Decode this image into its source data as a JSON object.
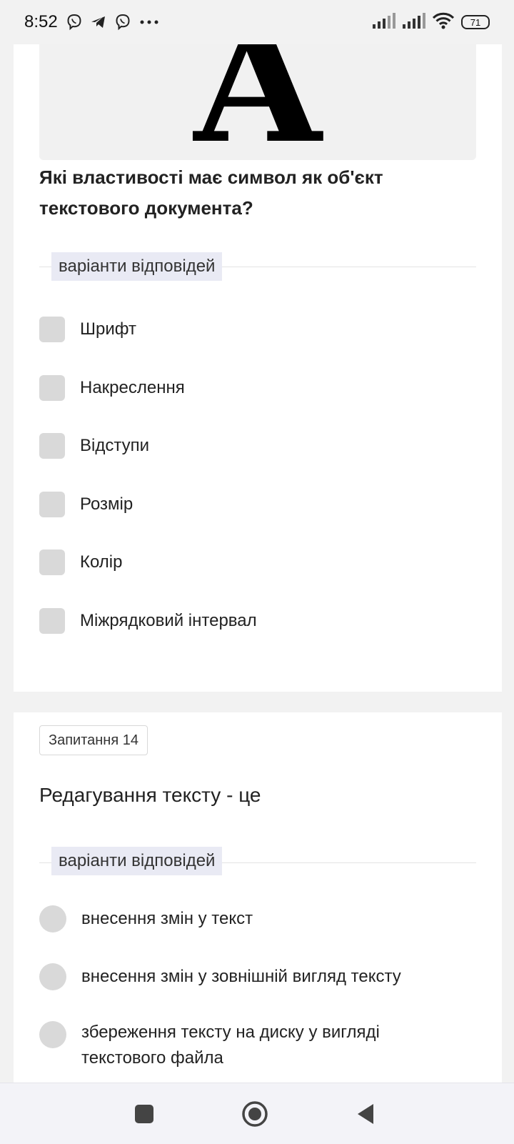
{
  "status_bar": {
    "time": "8:52",
    "left_icons": [
      "viber-icon",
      "telegram-icon",
      "viber-icon",
      "more-icon"
    ],
    "right_icons": [
      "signal-icon",
      "signal-icon",
      "wifi-icon",
      "battery-icon"
    ],
    "battery_level": "71"
  },
  "question13": {
    "image_letter": "A",
    "title": "Які властивості має символ як об'єкт текстового документа?",
    "answers_label": "варіанти відповідей",
    "options": [
      "Шрифт",
      "Накреслення",
      "Відступи",
      "Розмір",
      "Колір",
      "Міжрядковий інтервал"
    ]
  },
  "question14": {
    "badge": "Запитання 14",
    "text": "Редагування тексту - це",
    "answers_label": "варіанти відповідей",
    "options": [
      "внесення змін у текст",
      "внесення змін у зовнішній вигляд тексту",
      "збереження тексту на диску у вигляді текстового файла"
    ]
  },
  "nav_bar": {
    "buttons": [
      "recent-apps-button",
      "home-button",
      "back-button"
    ]
  }
}
